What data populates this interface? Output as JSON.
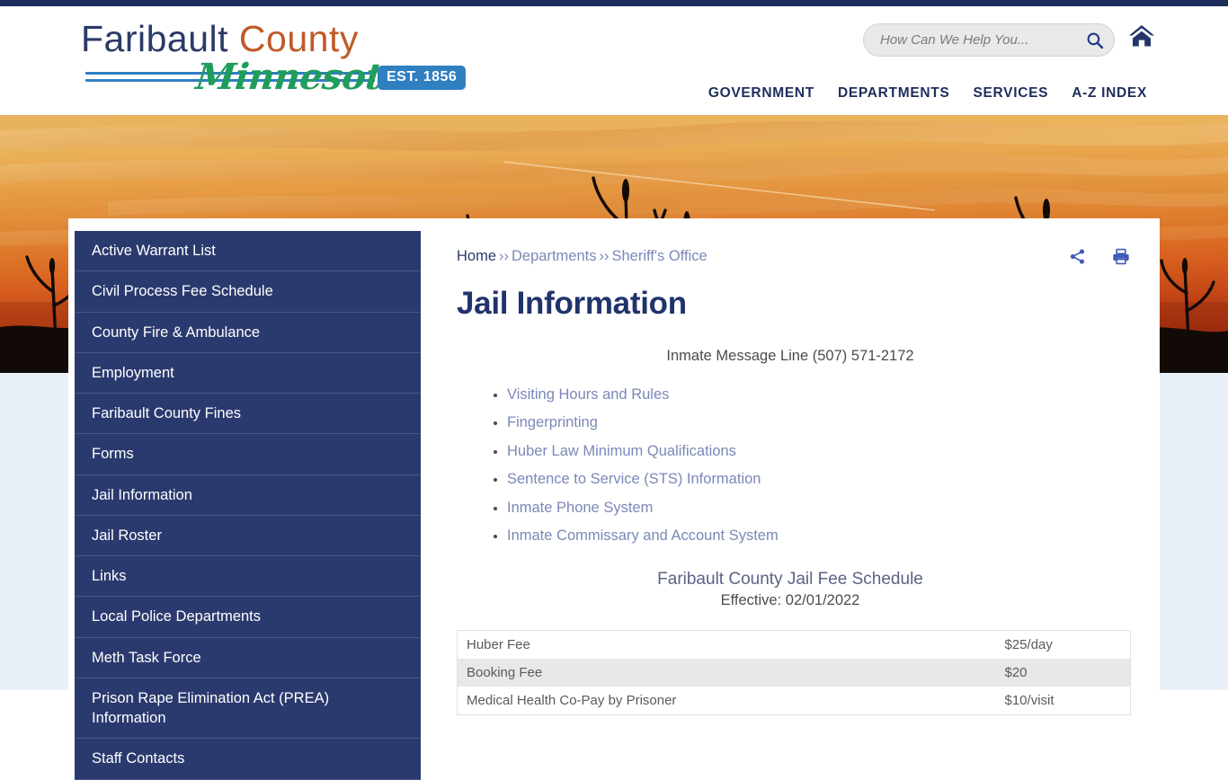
{
  "header": {
    "logo": {
      "line1_part1": "Faribault",
      "line1_part2": "County",
      "script": "Minnesota",
      "badge": "EST. 1856"
    },
    "search": {
      "placeholder": "How Can We Help You...",
      "value": "",
      "icon": "search-icon"
    },
    "home_icon": "home-icon",
    "nav": [
      {
        "label": "GOVERNMENT"
      },
      {
        "label": "DEPARTMENTS"
      },
      {
        "label": "SERVICES"
      },
      {
        "label": "A-Z INDEX"
      }
    ]
  },
  "sidebar": {
    "items": [
      {
        "label": "Active Warrant List"
      },
      {
        "label": "Civil Process Fee Schedule"
      },
      {
        "label": "County Fire & Ambulance"
      },
      {
        "label": "Employment"
      },
      {
        "label": "Faribault County Fines"
      },
      {
        "label": "Forms"
      },
      {
        "label": "Jail Information"
      },
      {
        "label": "Jail Roster"
      },
      {
        "label": "Links"
      },
      {
        "label": "Local Police Departments"
      },
      {
        "label": "Meth Task Force"
      },
      {
        "label": "Prison Rape Elimination Act (PREA) Information"
      },
      {
        "label": "Staff Contacts"
      }
    ]
  },
  "main": {
    "breadcrumb": {
      "home": "Home",
      "separator": "››",
      "departments": "Departments",
      "current": "Sheriff's Office"
    },
    "tools": {
      "share_icon": "share-icon",
      "print_icon": "print-icon"
    },
    "title": "Jail Information",
    "message_line": "Inmate Message Line (507) 571-2172",
    "links": [
      {
        "label": "Visiting Hours and Rules"
      },
      {
        "label": "Fingerprinting"
      },
      {
        "label": "Huber Law Minimum Qualifications"
      },
      {
        "label": "Sentence to Service (STS) Information"
      },
      {
        "label": "Inmate Phone System"
      },
      {
        "label": "Inmate Commissary and Account System"
      }
    ],
    "fee_schedule": {
      "title": "Faribault County Jail Fee Schedule",
      "effective": "Effective: 02/01/2022",
      "rows": [
        {
          "item": "Huber Fee",
          "amount": "$25/day"
        },
        {
          "item": "Booking Fee",
          "amount": "$20"
        },
        {
          "item": "Medical Health Co-Pay by Prisoner",
          "amount": "$10/visit"
        }
      ]
    }
  },
  "colors": {
    "navy": "#1e2e5c",
    "sidebar_navy": "#2b3a6e",
    "logo_orange": "#bf5a29",
    "logo_green": "#1f9d5a",
    "badge_blue": "#2f7fc1",
    "link_muted": "#7b88b8",
    "page_bg": "#eaf0f7"
  }
}
